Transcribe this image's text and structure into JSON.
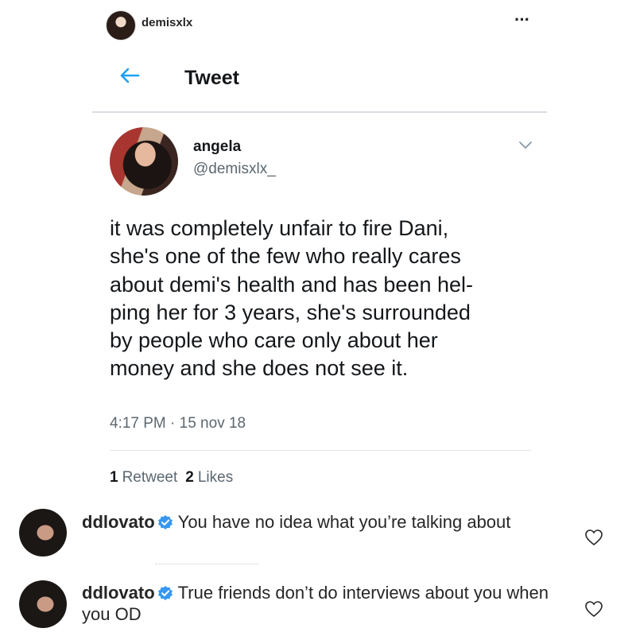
{
  "post": {
    "username": "demisxlx",
    "more_icon": "more-dots-icon"
  },
  "tweet": {
    "header_title": "Tweet",
    "back_icon": "back-arrow-icon",
    "author_name": "angela",
    "author_handle": "@demisxlx_",
    "text_lines": [
      "it was completely unfair to fire Dani,",
      "she's one of the few who really cares",
      "about demi's health and has been hel-",
      "ping her for 3 years, she's surrounded",
      "by people who care only about her",
      "money and she does not see it."
    ],
    "timestamp": "4:17 PM · 15 nov 18",
    "retweets_count": "1",
    "retweets_label": "Retweet",
    "likes_count": "2",
    "likes_label": "Likes",
    "accent_color": "#1da1f2"
  },
  "comments": [
    {
      "username": "ddlovato",
      "verified": true,
      "text": "You have no idea what you’re talking about"
    },
    {
      "username": "ddlovato",
      "verified": true,
      "text": "True friends don’t do interviews about you when you OD"
    }
  ]
}
